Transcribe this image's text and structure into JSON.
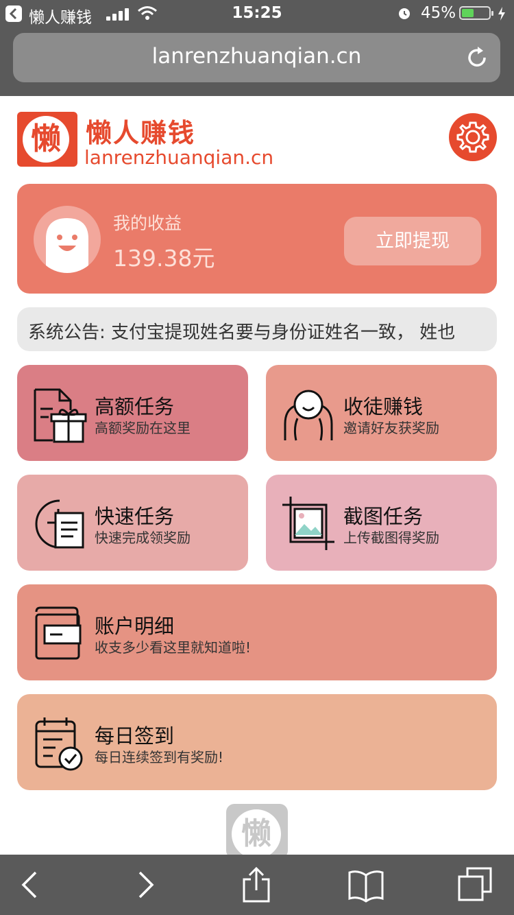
{
  "status": {
    "app_name": "懒人赚钱",
    "time": "15:25",
    "battery_pct": "45%",
    "battery_level": 0.45
  },
  "browser": {
    "url": "lanrenzhuanqian.cn"
  },
  "brand": {
    "logo_char": "懒",
    "name": "懒人赚钱",
    "url": "lanrenzhuanqian.cn"
  },
  "earnings": {
    "label": "我的收益",
    "amount": "139.38元",
    "withdraw_label": "立即提现"
  },
  "notice": {
    "text": "系统公告: 支付宝提现姓名要与身份证姓名一致， 姓也"
  },
  "tiles": [
    {
      "title": "高额任务",
      "subtitle": "高额奖励在这里",
      "icon": "gift-document-icon"
    },
    {
      "title": "收徒赚钱",
      "subtitle": "邀请好友获奖励",
      "icon": "people-icon"
    },
    {
      "title": "快速任务",
      "subtitle": "快速完成领奖励",
      "icon": "clock-document-icon"
    },
    {
      "title": "截图任务",
      "subtitle": "上传截图得奖励",
      "icon": "crop-image-icon"
    },
    {
      "title": "账户明细",
      "subtitle": "收支多少看这里就知道啦!",
      "icon": "wallet-icon"
    },
    {
      "title": "每日签到",
      "subtitle": "每日连续签到有奖励!",
      "icon": "calendar-check-icon"
    }
  ],
  "footer": {
    "logo_char": "懒"
  },
  "colors": {
    "brand": "#e64a2e",
    "card": "#ea7b69"
  }
}
